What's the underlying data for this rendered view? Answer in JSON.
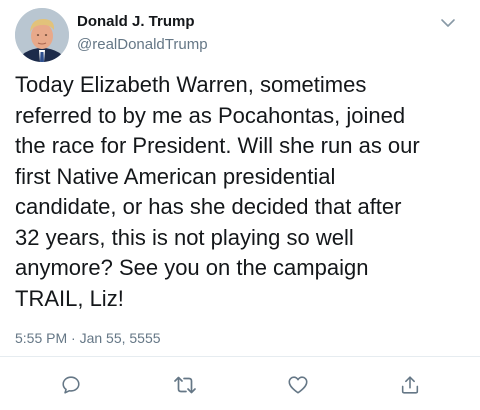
{
  "author": {
    "display_name": "Donald J. Trump",
    "handle": "@realDonaldTrump",
    "avatar_icon": "profile-photo"
  },
  "tweet": {
    "text": "Today Elizabeth Warren, sometimes\nreferred to by me as Pocahontas, joined\nthe race for President. Will she run as our\nfirst Native American presidential\ncandidate, or has she decided that after\n32 years, this is not playing so well\nanymore? See you on the campaign\nTRAIL, Liz!",
    "timestamp": "5:55 PM · Jan 55, 5555"
  },
  "menu": {
    "icon": "chevron-down-icon"
  },
  "actions": [
    {
      "name": "reply",
      "icon": "reply-icon"
    },
    {
      "name": "retweet",
      "icon": "retweet-icon"
    },
    {
      "name": "like",
      "icon": "heart-icon"
    },
    {
      "name": "share",
      "icon": "share-icon"
    }
  ],
  "colors": {
    "text": "#14171a",
    "secondary": "#657786",
    "icon": "#657786",
    "divider": "#e6ecf0"
  }
}
